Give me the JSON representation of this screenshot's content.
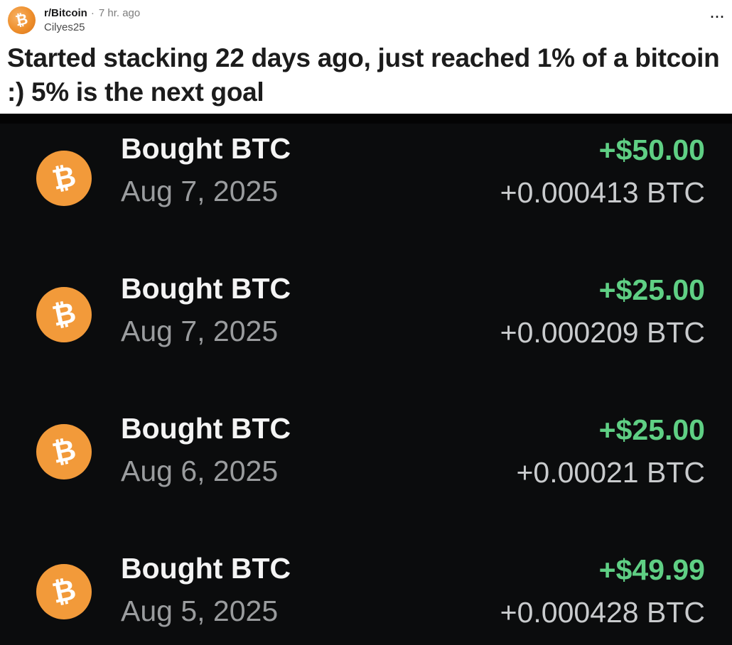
{
  "post": {
    "subreddit": "r/Bitcoin",
    "time": "7 hr. ago",
    "author": "Cilyes25",
    "avatar_glyph": "₿",
    "more_label": "···",
    "title": "Started stacking 22 days ago, just reached 1% of a bitcoin :) 5% is the next goal"
  },
  "transactions": [
    {
      "label": "Bought BTC",
      "date": "Aug 7, 2025",
      "usd": "+$50.00",
      "btc": "+0.000413 BTC",
      "icon": "₿"
    },
    {
      "label": "Bought BTC",
      "date": "Aug 7, 2025",
      "usd": "+$25.00",
      "btc": "+0.000209 BTC",
      "icon": "₿"
    },
    {
      "label": "Bought BTC",
      "date": "Aug 6, 2025",
      "usd": "+$25.00",
      "btc": "+0.00021 BTC",
      "icon": "₿"
    },
    {
      "label": "Bought BTC",
      "date": "Aug 5, 2025",
      "usd": "+$49.99",
      "btc": "+0.000428 BTC",
      "icon": "₿"
    }
  ],
  "colors": {
    "bitcoin_orange": "#f29a3a",
    "positive_green": "#5fcf84",
    "screenshot_bg": "#0b0c0d"
  }
}
